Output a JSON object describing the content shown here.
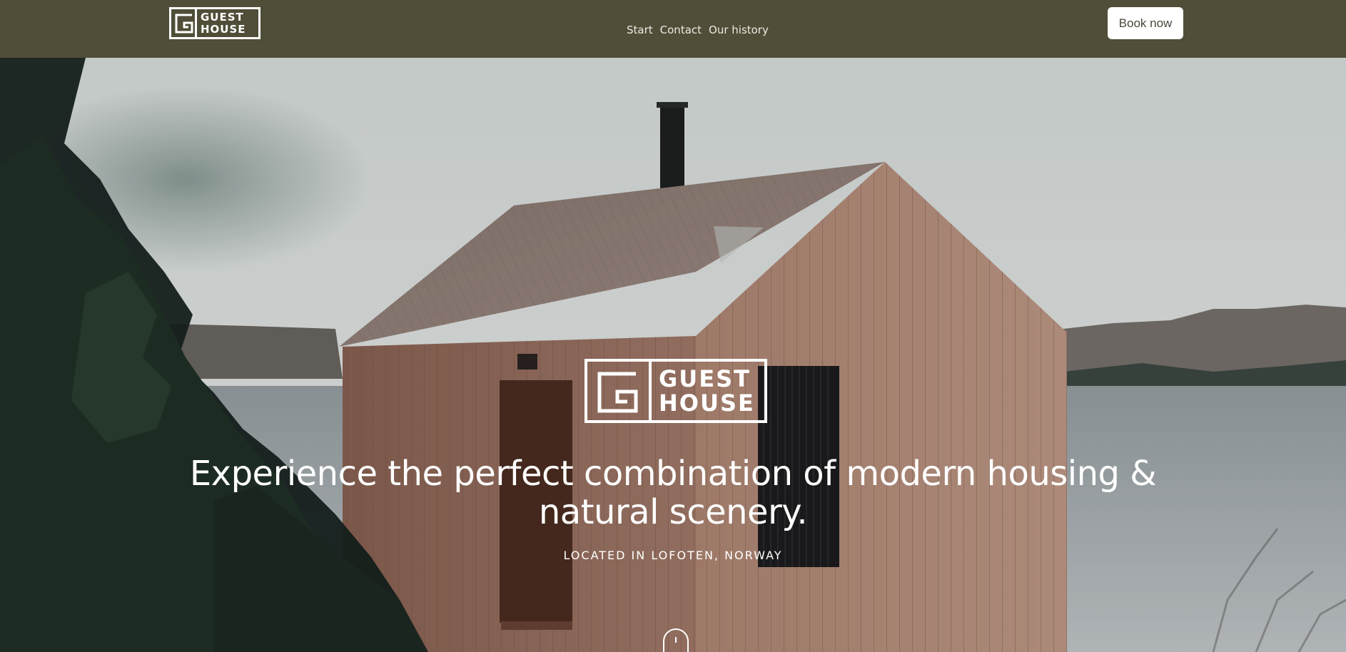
{
  "header": {
    "logo": {
      "line1": "GUEST",
      "line2": "HOUSE",
      "icon": "guesthouse-logo-mark"
    },
    "nav": [
      {
        "label": "Start"
      },
      {
        "label": "Contact"
      },
      {
        "label": "Our history"
      }
    ],
    "cta_label": "Book now"
  },
  "hero": {
    "logo": {
      "line1": "GUEST",
      "line2": "HOUSE",
      "icon": "guesthouse-logo-mark"
    },
    "headline_line1": "Experience the perfect combination of modern housing &",
    "headline_line2": "natural scenery.",
    "subline": "LOCATED IN LOFOTEN, NORWAY",
    "scroll_icon": "mouse-scroll-icon"
  },
  "colors": {
    "header_bg": "#504d38",
    "button_bg": "#ffffff",
    "button_text": "#4a473a",
    "hero_text": "#ffffff"
  }
}
